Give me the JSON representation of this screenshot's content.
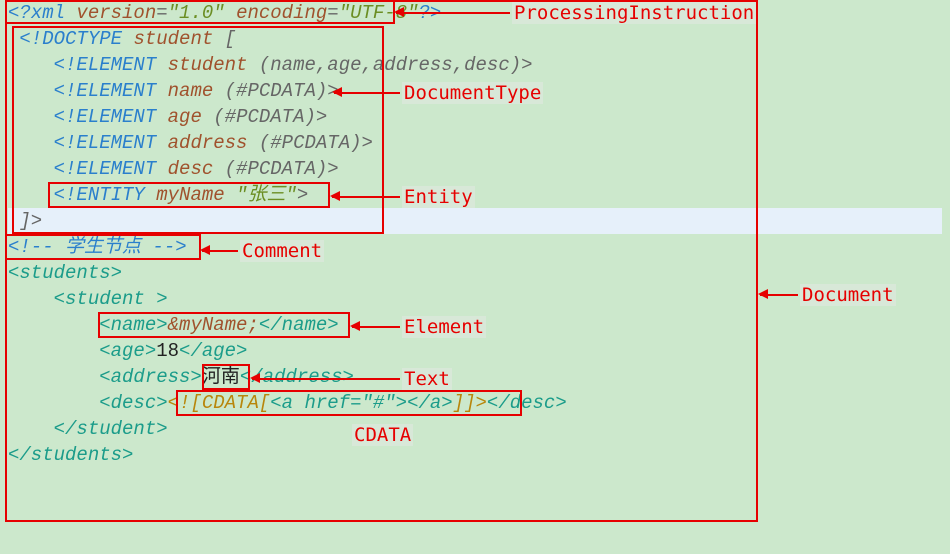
{
  "labels": {
    "processingInstruction": "ProcessingInstruction",
    "documentType": "DocumentType",
    "entity": "Entity",
    "comment": "Comment",
    "element": "Element",
    "text": "Text",
    "cdata": "CDATA",
    "document": "Document"
  },
  "xml": {
    "declaration": {
      "open": "<?xml",
      "version_attr": "version",
      "version_val": "\"1.0\"",
      "encoding_attr": "encoding",
      "encoding_val": "\"UTF-8\"",
      "close": "?>"
    },
    "doctype": {
      "open": "<!DOCTYPE",
      "root": "student",
      "bracket_open": "[",
      "bracket_close": "]>",
      "el_kw": "<!ELEMENT",
      "elements": [
        {
          "name": "student",
          "model": "(name,age,address,desc)"
        },
        {
          "name": "name",
          "model": "(#PCDATA)"
        },
        {
          "name": "age",
          "model": "(#PCDATA)"
        },
        {
          "name": "address",
          "model": "(#PCDATA)"
        },
        {
          "name": "desc",
          "model": "(#PCDATA)"
        }
      ],
      "entity_kw": "<!ENTITY",
      "entity_name": "myName",
      "entity_val": "\"张三\"",
      "gt": ">"
    },
    "comment": {
      "open": "<!--",
      "text": " 学生节点 ",
      "close": "-->"
    },
    "root_open": "<students>",
    "root_close": "</students>",
    "student_open": "<student",
    "student_gt": ">",
    "student_close": "</student>",
    "name_open": "<name>",
    "name_val": "&myName;",
    "name_close": "</name>",
    "age_open": "<age>",
    "age_val": "18",
    "age_close": "</age>",
    "addr_open": "<address>",
    "addr_val": "河南",
    "addr_close": "</address>",
    "desc_open": "<desc>",
    "desc_close": "</desc>",
    "cdata_open": "<![CDATA[",
    "cdata_content": "<a href=\"#\"></a>",
    "cdata_close": "]]>"
  }
}
